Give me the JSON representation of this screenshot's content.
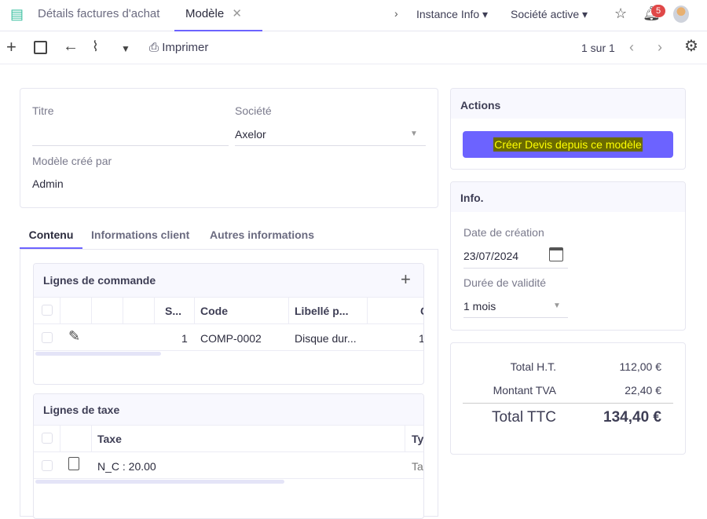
{
  "tabs": [
    {
      "label": "Détails factures d'achat",
      "active": false
    },
    {
      "label": "Modèle",
      "active": true
    }
  ],
  "header": {
    "instance_info": "Instance Info",
    "company_active": "Société active",
    "notifications_count": "5"
  },
  "toolbar": {
    "print_label": "Imprimer",
    "pager": "1 sur 1"
  },
  "form": {
    "title_label": "Titre",
    "title_value": "",
    "company_label": "Société",
    "company_value": "Axelor",
    "created_by_label": "Modèle créé par",
    "created_by_value": "Admin"
  },
  "subtabs": [
    "Contenu",
    "Informations client",
    "Autres informations"
  ],
  "order_lines": {
    "title": "Lignes de commande",
    "columns": [
      "S...",
      "Code",
      "Libellé p...",
      "C"
    ],
    "rows": [
      {
        "seq": "1",
        "code": "COMP-0002",
        "label": "Disque dur...",
        "qty": "1"
      }
    ]
  },
  "tax_lines": {
    "title": "Lignes de taxe",
    "columns": [
      "Taxe",
      "Ty"
    ],
    "rows": [
      {
        "tax": "N_C : 20.00",
        "type": "Ta:"
      }
    ]
  },
  "actions": {
    "title": "Actions",
    "button": "Créer Devis depuis ce modèle"
  },
  "info": {
    "title": "Info.",
    "creation_date_label": "Date de création",
    "creation_date": "23/07/2024",
    "validity_label": "Durée de validité",
    "validity_value": "1 mois"
  },
  "totals": {
    "ht_label": "Total H.T.",
    "ht_value": "112,00 €",
    "tva_label": "Montant TVA",
    "tva_value": "22,40 €",
    "ttc_label": "Total TTC",
    "ttc_value": "134,40 €"
  },
  "colors": {
    "accent": "#6c63ff",
    "highlight_bg": "#6b6b00",
    "highlight_text": "#ffff00",
    "badge": "#e04848"
  }
}
